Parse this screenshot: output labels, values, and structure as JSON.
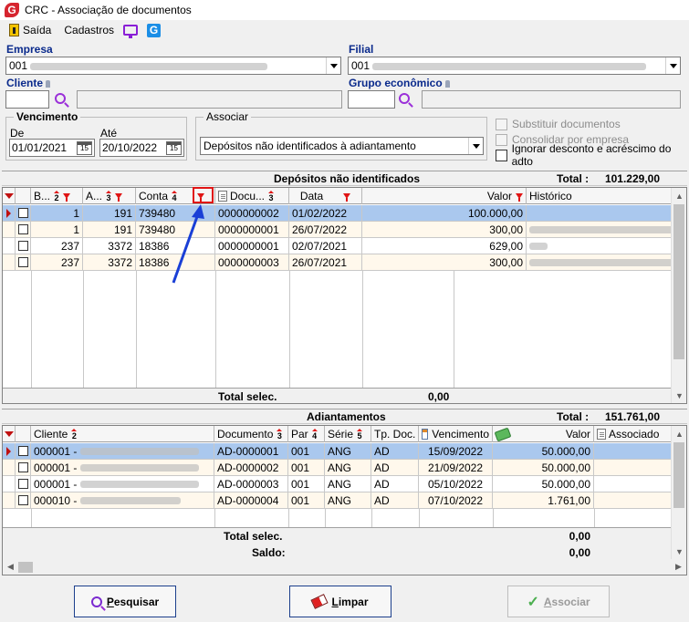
{
  "window": {
    "title": "CRC - Associação de documentos",
    "logo_letter": "G"
  },
  "menu": {
    "exit_label": "Saída",
    "cadastros_label": "Cadastros",
    "g_label": "G"
  },
  "form": {
    "empresa_label": "Empresa",
    "empresa_value": "001",
    "filial_label": "Filial",
    "filial_value": "001",
    "cliente_label": "Cliente",
    "grupo_label": "Grupo econômico",
    "vencimento_label": "Vencimento",
    "de_label": "De",
    "de_value": "01/01/2021",
    "ate_label": "Até",
    "ate_value": "20/10/2022",
    "cal_label": "15",
    "associar_label": "Associar",
    "associar_value": "Depósitos não identificados à adiantamento",
    "opt_substituir": "Substituir documentos",
    "opt_consolidar": "Consolidar por empresa",
    "opt_ignorar": "Ignorar desconto e acréscimo do adto"
  },
  "depositos": {
    "title": "Depósitos não identificados",
    "total_label": "Total :",
    "total_value": "101.229,00",
    "headers": {
      "b": "B...",
      "b_sort": "2",
      "a": "A...",
      "a_sort": "3",
      "conta": "Conta",
      "conta_sort": "4",
      "documento": "Docu...",
      "documento_sort": "3",
      "data": "Data",
      "valor": "Valor",
      "historico": "Histórico"
    },
    "rows": [
      {
        "b": "1",
        "a": "191",
        "conta": "739480",
        "documento": "0000000002",
        "data": "01/02/2022",
        "valor": "100.000,00"
      },
      {
        "b": "1",
        "a": "191",
        "conta": "739480",
        "documento": "0000000001",
        "data": "26/07/2022",
        "valor": "300,00"
      },
      {
        "b": "237",
        "a": "3372",
        "conta": "18386",
        "documento": "0000000001",
        "data": "02/07/2021",
        "valor": "629,00"
      },
      {
        "b": "237",
        "a": "3372",
        "conta": "18386",
        "documento": "0000000003",
        "data": "26/07/2021",
        "valor": "300,00"
      }
    ],
    "total_selec_label": "Total selec.",
    "total_selec_value": "0,00"
  },
  "adiantamentos": {
    "title": "Adiantamentos",
    "total_label": "Total :",
    "total_value": "151.761,00",
    "headers": {
      "cliente": "Cliente",
      "cliente_sort": "2",
      "documento": "Documento",
      "documento_sort": "3",
      "par": "Par",
      "par_sort": "4",
      "serie": "Série",
      "serie_sort": "5",
      "tp_doc": "Tp. Doc.",
      "vencimento": "Vencimento",
      "valor": "Valor",
      "associado": "Associado"
    },
    "rows": [
      {
        "cliente": "000001 -",
        "documento": "AD-0000001",
        "par": "001",
        "serie": "ANG",
        "tp_doc": "AD",
        "vencimento": "15/09/2022",
        "valor": "50.000,00"
      },
      {
        "cliente": "000001 -",
        "documento": "AD-0000002",
        "par": "001",
        "serie": "ANG",
        "tp_doc": "AD",
        "vencimento": "21/09/2022",
        "valor": "50.000,00"
      },
      {
        "cliente": "000001 -",
        "documento": "AD-0000003",
        "par": "001",
        "serie": "ANG",
        "tp_doc": "AD",
        "vencimento": "05/10/2022",
        "valor": "50.000,00"
      },
      {
        "cliente": "000010 -",
        "documento": "AD-0000004",
        "par": "001",
        "serie": "ANG",
        "tp_doc": "AD",
        "vencimento": "07/10/2022",
        "valor": "1.761,00"
      }
    ],
    "total_selec_label": "Total selec.",
    "total_selec_value": "0,00",
    "saldo_label": "Saldo:",
    "saldo_value": "0,00"
  },
  "buttons": {
    "pesquisar_first": "P",
    "pesquisar_rest": "esquisar",
    "limpar_first": "L",
    "limpar_rest": "impar",
    "associar_first": "A",
    "associar_rest": "ssociar"
  },
  "colors": {
    "selected_row": "#aac8ee",
    "alt_row": "#fff8ec",
    "filter_red": "#e01515",
    "label_blue": "#0a2a8c",
    "annotation_blue": "#1a3fd6"
  }
}
